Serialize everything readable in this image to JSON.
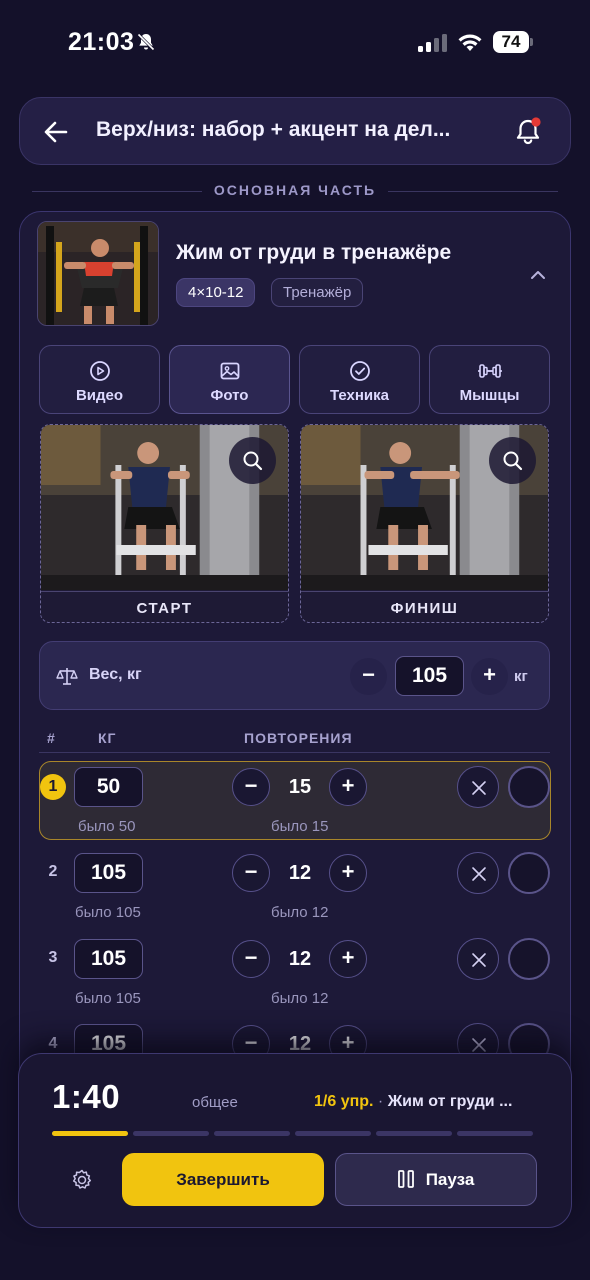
{
  "status_bar": {
    "time": "21:03",
    "battery": "74"
  },
  "header": {
    "title": "Верх/низ: набор + акцент на дел..."
  },
  "section": {
    "label": "ОСНОВНАЯ ЧАСТЬ"
  },
  "exercise": {
    "title": "Жим от груди в тренажёре",
    "sets_reps": "4×10-12",
    "equipment": "Тренажёр",
    "tabs": [
      {
        "label": "Видео",
        "icon": "play-icon"
      },
      {
        "label": "Фото",
        "icon": "image-icon"
      },
      {
        "label": "Техника",
        "icon": "check-icon"
      },
      {
        "label": "Мышцы",
        "icon": "dumbbell-icon"
      }
    ],
    "active_tab": "Фото",
    "photos": [
      {
        "caption": "СТАРТ"
      },
      {
        "caption": "ФИНИШ"
      }
    ],
    "weight": {
      "label": "Вес, кг",
      "value": "105",
      "unit": "кг",
      "minus": "−",
      "plus": "+"
    },
    "table_headers": {
      "num": "#",
      "kg": "КГ",
      "reps": "ПОВТОРЕНИЯ"
    },
    "sets": [
      {
        "num": "1",
        "kg": "50",
        "reps": "15",
        "prev_kg": "было 50",
        "prev_reps": "было 15",
        "active": true
      },
      {
        "num": "2",
        "kg": "105",
        "reps": "12",
        "prev_kg": "было 105",
        "prev_reps": "было 12",
        "active": false
      },
      {
        "num": "3",
        "kg": "105",
        "reps": "12",
        "prev_kg": "было 105",
        "prev_reps": "было 12",
        "active": false
      },
      {
        "num": "4",
        "kg": "105",
        "reps": "12",
        "prev_kg": "",
        "prev_reps": "",
        "active": false
      }
    ]
  },
  "session": {
    "timer": "1:40",
    "timer_label": "общее",
    "progress": "1/6 упр.",
    "separator": " · ",
    "current_exercise": "Жим от груди ...",
    "segments_total": 6,
    "segments_done": 1,
    "finish_label": "Завершить",
    "pause_label": "Пауза"
  },
  "colors": {
    "accent": "#f1c40f",
    "background": "#14112a",
    "card": "#1d1938"
  }
}
